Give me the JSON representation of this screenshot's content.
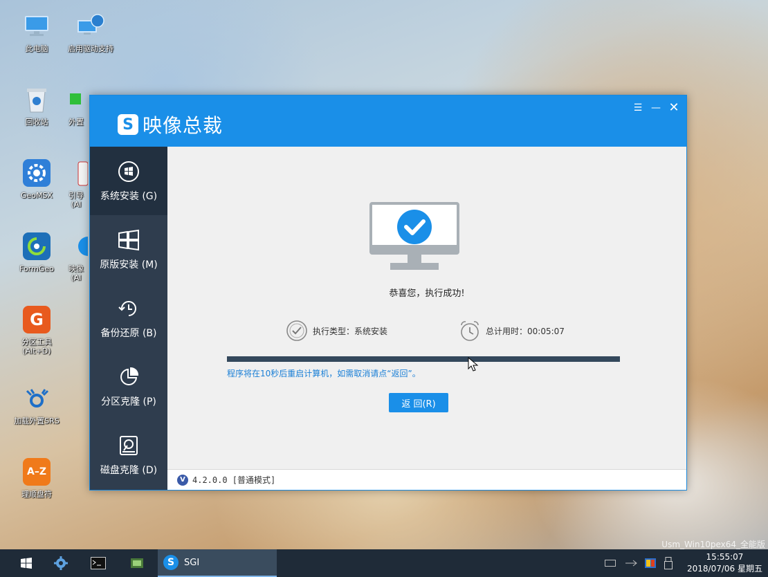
{
  "desktop": {
    "icons": [
      {
        "label": "此电脑",
        "icon": "computer-icon"
      },
      {
        "label": "启用驱动支持",
        "icon": "network-computer-icon"
      },
      {
        "label": "回收站",
        "icon": "recycle-bin-icon"
      },
      {
        "label": "外置",
        "icon": "folder-icon"
      },
      {
        "label": "GeoMSX",
        "icon": "geomsx-icon"
      },
      {
        "label": "引导",
        "sublabel": "(Al",
        "icon": "tool-icon"
      },
      {
        "label": "FormGeo",
        "icon": "formgeo-icon"
      },
      {
        "label": "映像",
        "sublabel": "(Al",
        "icon": "imaging-icon"
      },
      {
        "label": "分区工具",
        "sublabel": "(Alt+D)",
        "icon": "partition-tool-icon"
      },
      {
        "label": "加载外置SRS",
        "icon": "srs-icon"
      },
      {
        "label": "理顺盘符",
        "icon": "az-sort-icon"
      }
    ],
    "watermark": "Usm_Win10pex64_全能版"
  },
  "app": {
    "logo_letter": "S",
    "title": "映像总裁",
    "window_controls": {
      "menu": "☰",
      "minimize": "—",
      "close": "✕"
    },
    "nav": [
      {
        "label": "系统安装 (G)",
        "icon": "windows-logo-icon",
        "active": true
      },
      {
        "label": "原版安装 (M)",
        "icon": "windows-tiles-icon",
        "active": false
      },
      {
        "label": "备份还原 (B)",
        "icon": "backup-clock-icon",
        "active": false
      },
      {
        "label": "分区克隆 (P)",
        "icon": "pie-chart-icon",
        "active": false
      },
      {
        "label": "磁盘克隆 (D)",
        "icon": "disk-icon",
        "active": false
      }
    ],
    "result": {
      "message": "恭喜您，执行成功!",
      "exec_type": "执行类型：系统安装",
      "total_time": "总计用时：00:05:07",
      "progress": 1.0,
      "restart_note": "程序将在10秒后重启计算机，如需取消请点“返回”。",
      "back_button": "返 回(R)"
    },
    "status": {
      "version_badge": "V",
      "version_text": "4.2.0.0 [普通模式]"
    }
  },
  "taskbar": {
    "app_label": "SGI",
    "app_icon_letter": "S",
    "clock_time": "15:55:07",
    "clock_date": "2018/07/06 星期五"
  },
  "colors": {
    "accent": "#1a8fe8",
    "sidebar": "#2f3d4e",
    "sidebar_active": "#223040",
    "progress": "#34485c",
    "note": "#1a7fd6"
  }
}
